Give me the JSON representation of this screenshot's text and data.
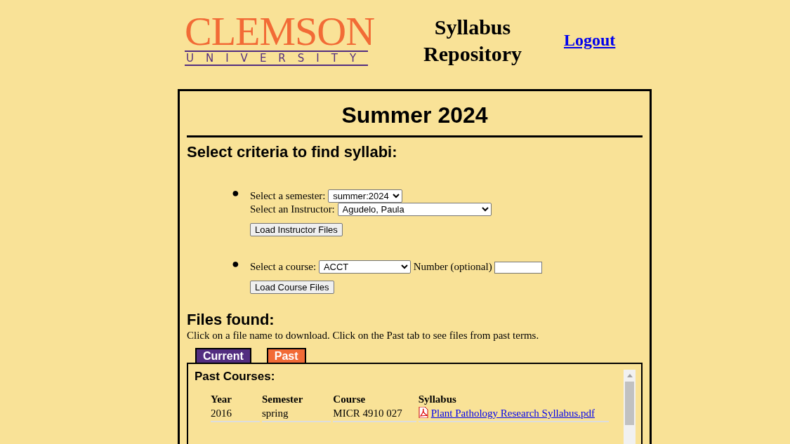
{
  "header": {
    "logo_name": "CLEMSON",
    "logo_sub": "UNIVERSITY",
    "title_line1": "Syllabus",
    "title_line2": "Repository",
    "logout": "Logout"
  },
  "term_title": "Summer 2024",
  "criteria_heading": "Select criteria to find syllabi:",
  "criteria": [
    {
      "kind": "instructor",
      "marker": "●",
      "semester_label": "Select a semester:",
      "semester_value": "summer:2024",
      "instructor_label": "Select an Instructor:",
      "instructor_value": "Agudelo, Paula",
      "button": "Load Instructor Files"
    },
    {
      "kind": "course",
      "marker": "●",
      "course_label": "Select a course:",
      "course_value": "ACCT",
      "number_label": "Number (optional)",
      "button": "Load Course Files"
    }
  ],
  "files_heading": "Files found:",
  "files_hint": "Click on a file name to download. Click on the Past tab to see files from past terms.",
  "tabs": [
    {
      "label": "Current",
      "selected": false
    },
    {
      "label": "Past",
      "selected": true
    }
  ],
  "panel": {
    "heading": "Past Courses:",
    "columns": [
      "Year",
      "Semester",
      "Course",
      "Syllabus"
    ],
    "rows": [
      {
        "year": "2016",
        "semester": "spring",
        "course": "MICR 4910 027",
        "file": "Plant Pathology Research Syllabus.pdf"
      }
    ]
  }
}
